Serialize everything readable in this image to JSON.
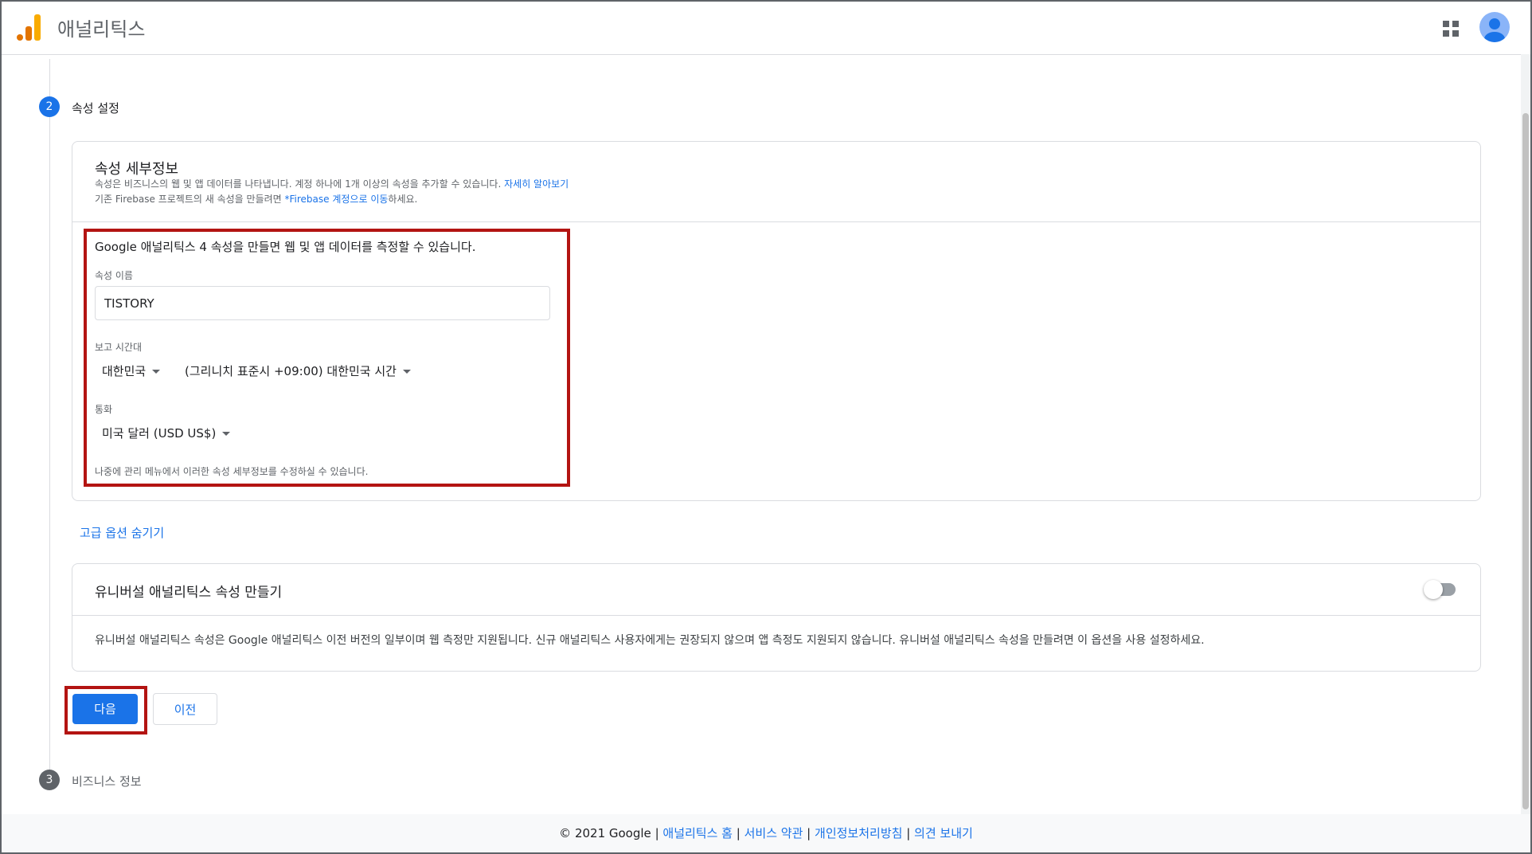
{
  "header": {
    "title": "애널리틱스"
  },
  "stepper": {
    "step2": {
      "number": "2",
      "label": "속성 설정"
    },
    "step3": {
      "number": "3",
      "label": "비즈니스 정보"
    }
  },
  "property_details": {
    "title": "속성 세부정보",
    "desc_line1": "속성은 비즈니스의 웹 및 앱 데이터를 나타냅니다. 계정 하나에 1개 이상의 속성을 추가할 수 있습니다.",
    "learn_more": "자세히 알아보기",
    "desc_line2_prefix": "기존 Firebase 프로젝트의 새 속성을 만들려면 ",
    "firebase_link": "*Firebase 계정으로 이동",
    "desc_line2_suffix": "하세요.",
    "ga4_intro": "Google 애널리틱스 4 속성을 만들면 웹 및 앱 데이터를 측정할 수 있습니다.",
    "name_label": "속성 이름",
    "name_value": "TISTORY",
    "timezone_label": "보고 시간대",
    "timezone_country": "대한민국",
    "timezone_value": "(그리니치 표준시 +09:00) 대한민국 시간",
    "currency_label": "통화",
    "currency_value": "미국 달러 (USD US$)",
    "edit_later_note": "나중에 관리 메뉴에서 이러한 속성 세부정보를 수정하실 수 있습니다."
  },
  "advanced_options_link": "고급 옵션 숨기기",
  "universal": {
    "title": "유니버설 애널리틱스 속성 만들기",
    "description": "유니버설 애널리틱스 속성은 Google 애널리틱스 이전 버전의 일부이며 웹 측정만 지원됩니다. 신규 애널리틱스 사용자에게는 권장되지 않으며 앱 측정도 지원되지 않습니다. 유니버설 애널리틱스 속성을 만들려면 이 옵션을 사용 설정하세요.",
    "toggle_on": false
  },
  "buttons": {
    "next": "다음",
    "prev": "이전"
  },
  "footer": {
    "copyright": "© 2021 Google",
    "sep": "|",
    "links": [
      "애널리틱스 홈",
      "서비스 약관",
      "개인정보처리방침",
      "의견 보내기"
    ]
  },
  "colors": {
    "primary": "#1a73e8",
    "highlight": "#b31412",
    "step_inactive": "#5f6368"
  },
  "icons": [
    "analytics-logo-icon",
    "apps-grid-icon",
    "account-avatar-icon",
    "dropdown-caret-icon"
  ]
}
